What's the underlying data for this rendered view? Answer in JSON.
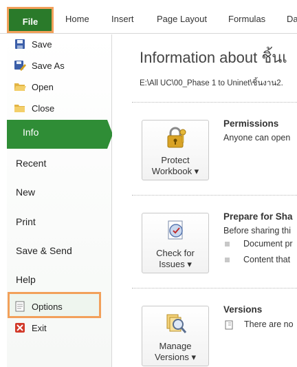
{
  "ribbon": {
    "file_tab": "File",
    "tabs": [
      "Home",
      "Insert",
      "Page Layout",
      "Formulas",
      "Da"
    ]
  },
  "nav": {
    "small_items": [
      "Save",
      "Save As",
      "Open",
      "Close"
    ],
    "active_item": "Info",
    "big_items": [
      "Recent",
      "New",
      "Print",
      "Save & Send",
      "Help"
    ],
    "options": "Options",
    "exit": "Exit"
  },
  "main": {
    "title": "Information about ชิ้นเ",
    "path": "E:\\All UC\\00_Phase 1 to Uninet\\ชิ้นงาน2.",
    "permissions": {
      "button_line1": "Protect",
      "button_line2": "Workbook ▾",
      "heading": "Permissions",
      "text": "Anyone can open"
    },
    "prepare": {
      "button_line1": "Check for",
      "button_line2": "Issues ▾",
      "heading": "Prepare for Sha",
      "text": "Before sharing thi",
      "bullets": [
        "Document pr",
        "Content that"
      ]
    },
    "versions": {
      "button_line1": "Manage",
      "button_line2": "Versions ▾",
      "heading": "Versions",
      "text": "There are no"
    }
  },
  "colors": {
    "file_green": "#2a7a2a",
    "active_green": "#2f8d36",
    "highlight_orange": "#f2a05a"
  }
}
